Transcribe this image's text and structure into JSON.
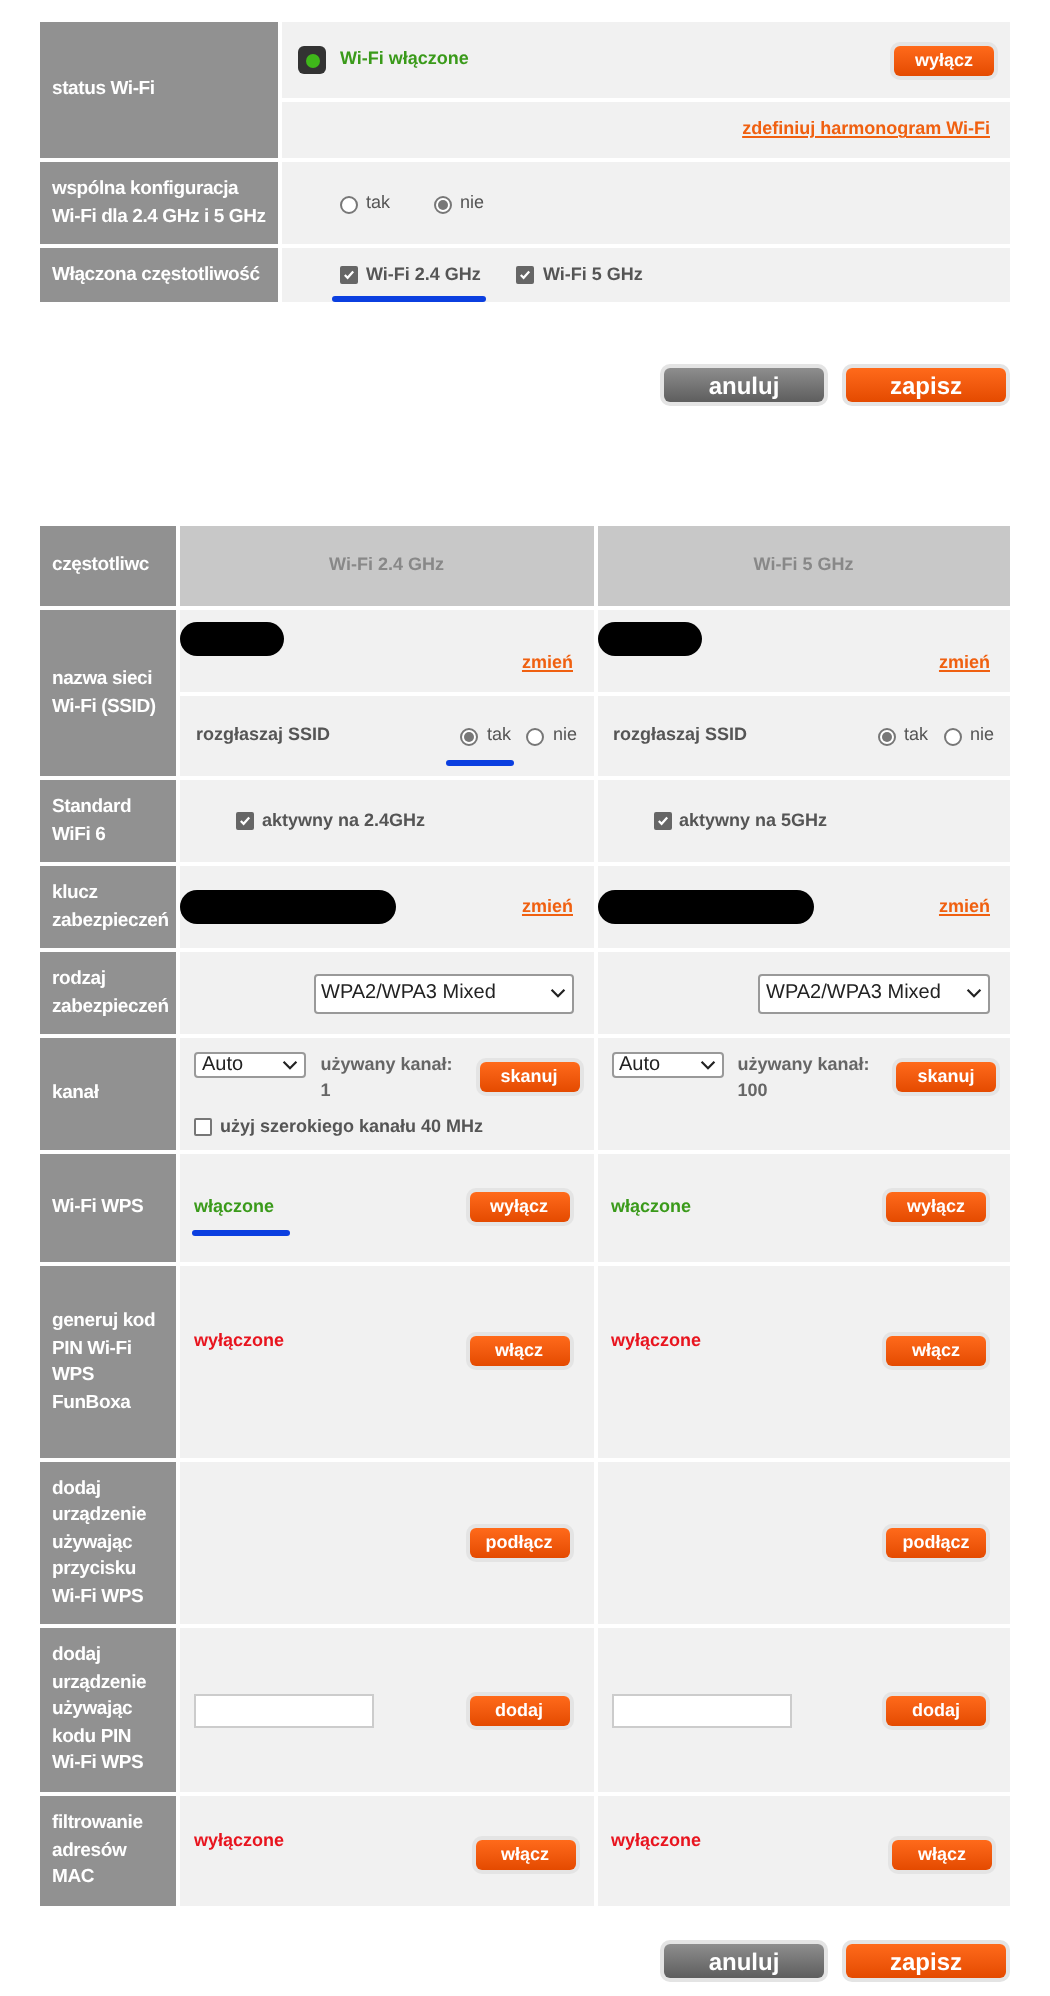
{
  "wifi_status": {
    "label": "status Wi-Fi",
    "on": true,
    "status_text": "Wi-Fi włączone",
    "toggle_button": "wyłącz",
    "schedule_link": "zdefiniuj harmonogram Wi-Fi"
  },
  "shared_config": {
    "label": "wspólna konfiguracja Wi-Fi dla 2.4 GHz i 5 GHz",
    "options": [
      {
        "label": "tak",
        "selected": false
      },
      {
        "label": "nie",
        "selected": true
      }
    ]
  },
  "enabled_frequency": {
    "label": "Włączona częstotliwość",
    "options": [
      {
        "label": "Wi-Fi 2.4 GHz",
        "checked": true
      },
      {
        "label": "Wi-Fi 5 GHz",
        "checked": true
      }
    ]
  },
  "top_actions": [
    {
      "label": "anuluj",
      "kind": "cancel"
    },
    {
      "label": "zapisz",
      "kind": "save"
    }
  ],
  "bands_table": {
    "row_labels": {
      "frequency": "częstotliwc",
      "ssid": "nazwa sieci Wi-Fi (SSID)",
      "wifi6": "Standard WiFi 6",
      "key": "klucz zabezpieczeń",
      "security": "rodzaj zabezpieczeń",
      "channel": "kanał",
      "wps": "Wi-Fi WPS",
      "pin_gen": "generuj kod PIN Wi-Fi WPS FunBoxa",
      "push_button": "dodaj urządzenie używając przycisku Wi-Fi WPS",
      "pin_add": "dodaj urządzenie używając kodu PIN Wi-Fi WPS",
      "mac_filter": "filtrowanie adresów MAC"
    },
    "bands": [
      {
        "title": "Wi-Fi 2.4 GHz",
        "ssid_change_link": "zmień",
        "broadcast_label": "rozgłaszaj SSID",
        "broadcast_options": [
          {
            "label": "tak",
            "selected": true
          },
          {
            "label": "nie",
            "selected": false
          }
        ],
        "wifi6": {
          "label": "aktywny na 2.4GHz",
          "checked": true
        },
        "key_change_link": "zmień",
        "security_select": "WPA2/WPA3 Mixed",
        "channel_select": "Auto",
        "channel_used": "używany kanał: 1",
        "scan_button": "skanuj",
        "wide_channel": {
          "label": "użyj szerokiego kanału 40 MHz",
          "checked": false
        },
        "wps": {
          "status": "włączone",
          "on": true,
          "button": "wyłącz"
        },
        "pin_gen": {
          "status": "wyłączone",
          "on": false,
          "button": "włącz"
        },
        "push_button": "podłącz",
        "pin_add_button": "dodaj",
        "mac_filter": {
          "status": "wyłączone",
          "on": false,
          "button": "włącz"
        }
      },
      {
        "title": "Wi-Fi 5 GHz",
        "ssid_change_link": "zmień",
        "broadcast_label": "rozgłaszaj SSID",
        "broadcast_options": [
          {
            "label": "tak",
            "selected": true
          },
          {
            "label": "nie",
            "selected": false
          }
        ],
        "wifi6": {
          "label": "aktywny na 5GHz",
          "checked": true
        },
        "key_change_link": "zmień",
        "security_select": "WPA2/WPA3 Mixed",
        "channel_select": "Auto",
        "channel_used": "używany kanał: 100",
        "scan_button": "skanuj",
        "wps": {
          "status": "włączone",
          "on": true,
          "button": "wyłącz"
        },
        "pin_gen": {
          "status": "wyłączone",
          "on": false,
          "button": "włącz"
        },
        "push_button": "podłącz",
        "pin_add_button": "dodaj",
        "mac_filter": {
          "status": "wyłączone",
          "on": false,
          "button": "włącz"
        }
      }
    ]
  },
  "bottom_actions": [
    {
      "label": "anuluj",
      "kind": "cancel"
    },
    {
      "label": "zapisz",
      "kind": "save"
    }
  ]
}
